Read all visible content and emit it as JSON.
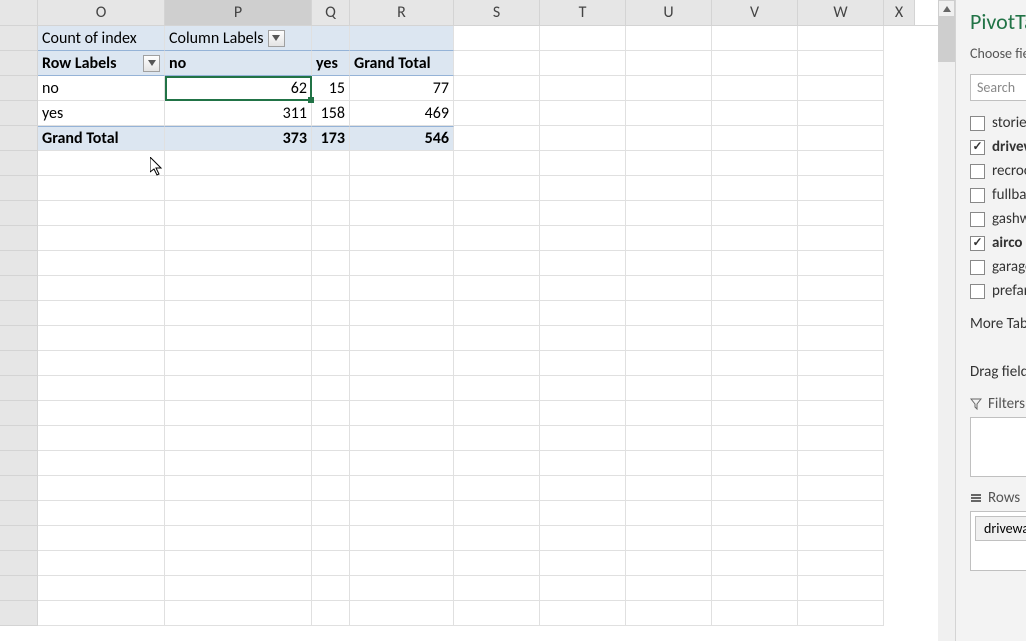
{
  "columns": [
    "O",
    "P",
    "Q",
    "R",
    "S",
    "T",
    "U",
    "V",
    "W",
    "X"
  ],
  "pivot": {
    "count_label": "Count of index",
    "column_labels": "Column Labels",
    "row_labels": "Row Labels",
    "col_no": "no",
    "col_yes": "yes",
    "col_grand_total": "Grand Total",
    "rows": [
      {
        "label": "no",
        "no": "62",
        "yes": "15",
        "total": "77"
      },
      {
        "label": "yes",
        "no": "311",
        "yes": "158",
        "total": "469"
      }
    ],
    "grand_total": {
      "label": "Grand Total",
      "no": "373",
      "yes": "173",
      "total": "546"
    }
  },
  "panel": {
    "title": "PivotTable Fields",
    "choose": "Choose fields to add to report:",
    "search_placeholder": "Search",
    "fields": [
      {
        "label": "stories",
        "checked": false
      },
      {
        "label": "driveway",
        "checked": true
      },
      {
        "label": "recroom",
        "checked": false
      },
      {
        "label": "fullbase",
        "checked": false
      },
      {
        "label": "gashw",
        "checked": false
      },
      {
        "label": "airco",
        "checked": true
      },
      {
        "label": "garagepl",
        "checked": false
      },
      {
        "label": "prefarea",
        "checked": false
      }
    ],
    "more_tables": "More Tables...",
    "drag_label": "Drag fields between areas below:",
    "filters_label": "Filters",
    "rows_label": "Rows",
    "row_field": "driveway"
  }
}
